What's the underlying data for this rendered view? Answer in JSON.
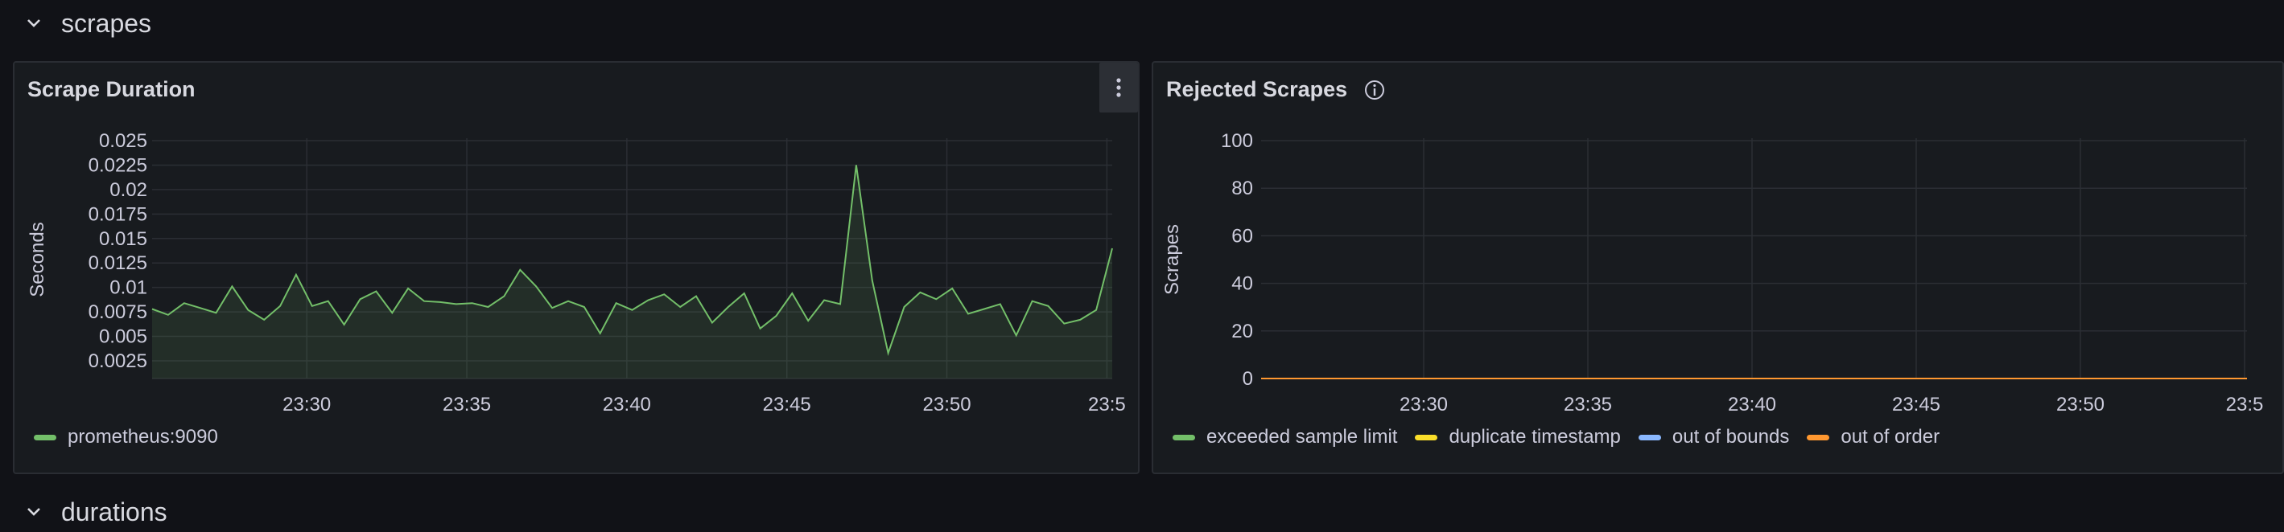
{
  "rows": [
    {
      "title": "scrapes"
    },
    {
      "title": "durations"
    }
  ],
  "panels": {
    "scrape_duration": {
      "title": "Scrape Duration",
      "legend": [
        {
          "label": "prometheus:9090",
          "color": "#73bf69"
        }
      ]
    },
    "rejected_scrapes": {
      "title": "Rejected Scrapes",
      "legend": [
        {
          "label": "exceeded sample limit",
          "color": "#73bf69"
        },
        {
          "label": "duplicate timestamp",
          "color": "#fade2a"
        },
        {
          "label": "out of bounds",
          "color": "#8ab8ff"
        },
        {
          "label": "out of order",
          "color": "#ff9830"
        }
      ]
    }
  },
  "chart_data": [
    {
      "type": "area",
      "ylabel": "Seconds",
      "yticks": [
        "0.025",
        "0.0225",
        "0.02",
        "0.0175",
        "0.015",
        "0.0125",
        "0.01",
        "0.0075",
        "0.005",
        "0.0025"
      ],
      "ylim": [
        0.0025,
        0.025
      ],
      "xticks": [
        "23:30",
        "23:35",
        "23:40",
        "23:45",
        "23:50",
        "23:5"
      ],
      "xlim": [
        "23:25:10",
        "23:55:10"
      ],
      "series": [
        {
          "name": "prometheus:9090",
          "color": "#73bf69",
          "x": [
            "23:25:10",
            "23:25:40",
            "23:26:10",
            "23:26:40",
            "23:27:10",
            "23:27:40",
            "23:28:10",
            "23:28:40",
            "23:29:10",
            "23:29:40",
            "23:30:10",
            "23:30:40",
            "23:31:10",
            "23:31:40",
            "23:32:10",
            "23:32:40",
            "23:33:10",
            "23:33:40",
            "23:34:10",
            "23:34:40",
            "23:35:10",
            "23:35:40",
            "23:36:10",
            "23:36:40",
            "23:37:10",
            "23:37:40",
            "23:38:10",
            "23:38:40",
            "23:39:10",
            "23:39:40",
            "23:40:10",
            "23:40:40",
            "23:41:10",
            "23:41:40",
            "23:42:10",
            "23:42:40",
            "23:43:10",
            "23:43:40",
            "23:44:10",
            "23:44:40",
            "23:45:10",
            "23:45:40",
            "23:46:10",
            "23:46:40",
            "23:47:10",
            "23:47:40",
            "23:48:10",
            "23:48:40",
            "23:49:10",
            "23:49:40",
            "23:50:10",
            "23:50:40",
            "23:51:10",
            "23:51:40",
            "23:52:10",
            "23:52:40",
            "23:53:10",
            "23:53:40",
            "23:54:10",
            "23:54:40",
            "23:55:10"
          ],
          "values": [
            0.0078,
            0.0072,
            0.0084,
            0.0079,
            0.0074,
            0.0101,
            0.0077,
            0.0067,
            0.0081,
            0.0113,
            0.0081,
            0.0086,
            0.0062,
            0.0088,
            0.0096,
            0.0074,
            0.0099,
            0.0086,
            0.0085,
            0.0083,
            0.0084,
            0.008,
            0.0091,
            0.0118,
            0.0101,
            0.0079,
            0.0086,
            0.008,
            0.0053,
            0.0084,
            0.0077,
            0.0087,
            0.0093,
            0.008,
            0.0091,
            0.0064,
            0.008,
            0.0094,
            0.0058,
            0.0071,
            0.0094,
            0.0066,
            0.0087,
            0.0083,
            0.0225,
            0.0107,
            0.0033,
            0.008,
            0.0095,
            0.0088,
            0.0099,
            0.0073,
            0.0078,
            0.0083,
            0.0051,
            0.0086,
            0.0081,
            0.0063,
            0.0067,
            0.0077,
            0.014
          ]
        }
      ]
    },
    {
      "type": "line",
      "ylabel": "Scrapes",
      "yticks": [
        "100",
        "80",
        "60",
        "40",
        "20",
        "0"
      ],
      "ylim": [
        0,
        100
      ],
      "xticks": [
        "23:30",
        "23:35",
        "23:40",
        "23:45",
        "23:50",
        "23:5"
      ],
      "series": [
        {
          "name": "exceeded sample limit",
          "color": "#73bf69",
          "values": [
            0,
            0
          ]
        },
        {
          "name": "duplicate timestamp",
          "color": "#fade2a",
          "values": [
            0,
            0
          ]
        },
        {
          "name": "out of bounds",
          "color": "#8ab8ff",
          "values": [
            0,
            0
          ]
        },
        {
          "name": "out of order",
          "color": "#ff9830",
          "values": [
            0,
            0
          ]
        }
      ]
    }
  ]
}
